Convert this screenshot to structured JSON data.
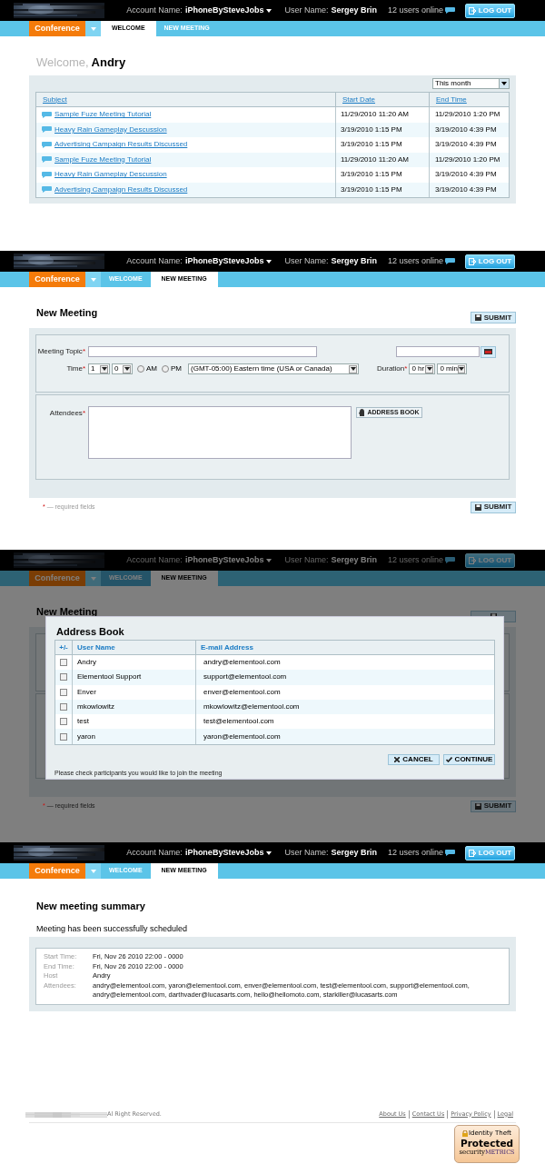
{
  "screens": [
    {
      "kind": "welcome",
      "header": {
        "account_label": "Account Name:",
        "account_name": "iPhoneBySteveJobs",
        "user_label": "User Name:",
        "user_name": "Sergey Brin",
        "online": "12 users online",
        "logout": "LOG OUT"
      },
      "app": "Conference",
      "tabs": [
        {
          "label": "WELCOME",
          "selected": true
        },
        {
          "label": "NEW MEETING",
          "selected": false
        }
      ],
      "greeting": "Welcome,",
      "user": "Andry",
      "filter": "This month",
      "columns": [
        "Subject",
        "Start Date",
        "End Time"
      ],
      "rows": [
        {
          "subject": "Sample Fuze Meeting Tutorial",
          "start": "11/29/2010 11:20 AM",
          "end": "11/29/2010 1:20 PM"
        },
        {
          "subject": "Heavy Rain Gameplay Descussion",
          "start": "3/19/2010 1:15 PM",
          "end": "3/19/2010 4:39 PM"
        },
        {
          "subject": "Advertising Campaign Results Discussed",
          "start": "3/19/2010 1:15 PM",
          "end": "3/19/2010 4:39 PM"
        },
        {
          "subject": "Sample Fuze Meeting Tutorial",
          "start": "11/29/2010 11:20 AM",
          "end": "11/29/2010 1:20 PM"
        },
        {
          "subject": "Heavy Rain Gameplay Descussion",
          "start": "3/19/2010 1:15 PM",
          "end": "3/19/2010 4:39 PM"
        },
        {
          "subject": "Advertising Campaign Results Discussed",
          "start": "3/19/2010 1:15 PM",
          "end": "3/19/2010 4:39 PM"
        }
      ]
    },
    {
      "kind": "new_meeting",
      "header": {
        "account_label": "Account Name:",
        "account_name": "iPhoneBySteveJobs",
        "user_label": "User Name:",
        "user_name": "Sergey Brin",
        "online": "12 users online",
        "logout": "LOG OUT"
      },
      "app": "Conference",
      "tabs": [
        {
          "label": "WELCOME",
          "selected": false
        },
        {
          "label": "NEW MEETING",
          "selected": true
        }
      ],
      "title": "New Meeting",
      "submit_top": "SUBMIT",
      "submit_bottom": "SUBMIT",
      "required_mark": "*",
      "required_note": "— required fields",
      "form": {
        "topic": {
          "label": "Meeting Topic",
          "required": true
        },
        "time": {
          "label": "Time",
          "required": true,
          "hour": "1",
          "minute": "0"
        },
        "meridiem": [
          {
            "label": "AM",
            "selected": false
          },
          {
            "label": "PM",
            "selected": false
          }
        ],
        "timezone": "(GMT-05:00) Eastern time (USA or Canada)",
        "duration": {
          "label": "Duration",
          "required": true,
          "hours": "0 hr",
          "minutes": "0 min"
        },
        "attendees": {
          "label": "Attendees",
          "required": true
        },
        "address_book_button": "ADDRESS BOOK"
      }
    },
    {
      "kind": "new_meeting",
      "dimmed": true,
      "header": {
        "account_label": "Account Name:",
        "account_name": "iPhoneBySteveJobs",
        "user_label": "User Name:",
        "user_name": "Sergey Brin",
        "online": "12 users online",
        "logout": "LOG OUT"
      },
      "app": "Conference",
      "tabs": [
        {
          "label": "WELCOME",
          "selected": false
        },
        {
          "label": "NEW MEETING",
          "selected": true
        }
      ],
      "title": "New Meeting",
      "submit_bottom": "SUBMIT",
      "required_mark": "*",
      "required_note": "— required fields",
      "modal": {
        "title": "Address Book",
        "columns": [
          "+/-",
          "User Name",
          "E-mail Address"
        ],
        "rows": [
          {
            "name": "Andry",
            "email": "andry@elementool.com",
            "checked": false
          },
          {
            "name": "Elementool Support",
            "email": "support@elementool.com",
            "checked": false
          },
          {
            "name": "Enver",
            "email": "enver@elementool.com",
            "checked": false
          },
          {
            "name": "mkowlowitz",
            "email": "mkowlowitz@elementool.com",
            "checked": false
          },
          {
            "name": "test",
            "email": "test@elementool.com",
            "checked": false
          },
          {
            "name": "yaron",
            "email": "yaron@elementool.com",
            "checked": false
          }
        ],
        "cancel": "CANCEL",
        "continue": "CONTINUE",
        "hint": "Please check participants you would like to join the meeting"
      }
    },
    {
      "kind": "summary",
      "header": {
        "account_label": "Account Name:",
        "account_name": "iPhoneBySteveJobs",
        "user_label": "User Name:",
        "user_name": "Sergey Brin",
        "online": "12 users online",
        "logout": "LOG OUT"
      },
      "app": "Conference",
      "tabs": [
        {
          "label": "WELCOME",
          "selected": false
        },
        {
          "label": "NEW MEETING",
          "selected": true
        }
      ],
      "title": "New meeting summary",
      "message": "Meeting has been successfully scheduled",
      "details": [
        {
          "label": "Start Time:",
          "value": "Fri, Nov 26 2010 22:00 - 0000"
        },
        {
          "label": "End Time:",
          "value": "Fri, Nov 26 2010 22:00 - 0000"
        },
        {
          "label": "Host",
          "value": "Andry"
        },
        {
          "label": "Attendees:",
          "value": "andry@elementool.com, yaron@elementool.com, enver@elementool.com, test@elementool.com, support@elementool.com, andry@elementool.com, darthvader@lucasarts.com, hello@hellomoto.com, starkiller@lucasarts.com"
        }
      ]
    }
  ],
  "footer": {
    "copyright": "Al Right Reserved.",
    "links": [
      "About Us",
      "Contact Us",
      "Privacy Policy",
      "Legal"
    ],
    "badge": {
      "line_1": "Identity Theft",
      "line_2": "Protected",
      "brand_a": "security",
      "brand_b": "METRICS"
    }
  }
}
